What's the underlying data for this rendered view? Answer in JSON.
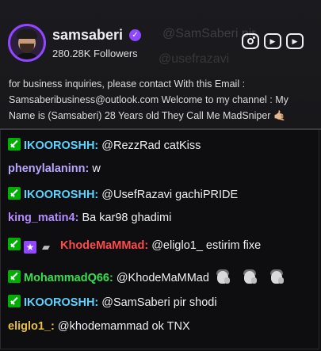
{
  "channel": {
    "name": "samsaberi",
    "followers": "280.28K Followers",
    "bio": "for business inquiries, please contact With this Email : Samsaberibusiness@outlook.com Welcome to my channel : My Name is (Samsaberi) 28 Years old They Call Me MadSniper 🤙🏼",
    "ghost_text_1": "@SamSaberi pir",
    "ghost_text_2": "@usefrazavi",
    "socials": [
      "instagram-icon",
      "youtube-icon",
      "youtube-icon"
    ]
  },
  "colors": {
    "accent": "#9147ff",
    "mod_badge": "#00ad03"
  },
  "messages": [
    {
      "user": "IKOOROSHH:",
      "color": "#5fd3ff",
      "text": "@RezzRad catKiss",
      "badges": [
        "sword"
      ]
    },
    {
      "user": "phenylalaninn:",
      "color": "#b9a6ff",
      "text": "w",
      "badges": []
    },
    {
      "user": "IKOOROSHH:",
      "color": "#5fd3ff",
      "text": "@UsefRazavi gachiPRIDE",
      "badges": [
        "sword"
      ]
    },
    {
      "user": "king_matin4:",
      "color": "#b58cff",
      "text": "Ba kar98 ghadimi",
      "badges": []
    },
    {
      "user": "KhodeMaMMad:",
      "color": "#ff4b4b",
      "text": "@eliglo1_ estirim fixe",
      "badges": [
        "sword",
        "star",
        "bits"
      ]
    },
    {
      "user": "MohammadQ66:",
      "color": "#35e04e",
      "text": "@KhodeMaMMad",
      "badges": [
        "sword"
      ],
      "emotes": 3
    },
    {
      "user": "IKOOROSHH:",
      "color": "#5fd3ff",
      "text": "@SamSaberi pir shodi",
      "badges": [
        "sword"
      ]
    },
    {
      "user": "eliglo1_:",
      "color": "#e9c23d",
      "text": "@khodemammad ok TNX",
      "badges": []
    }
  ]
}
